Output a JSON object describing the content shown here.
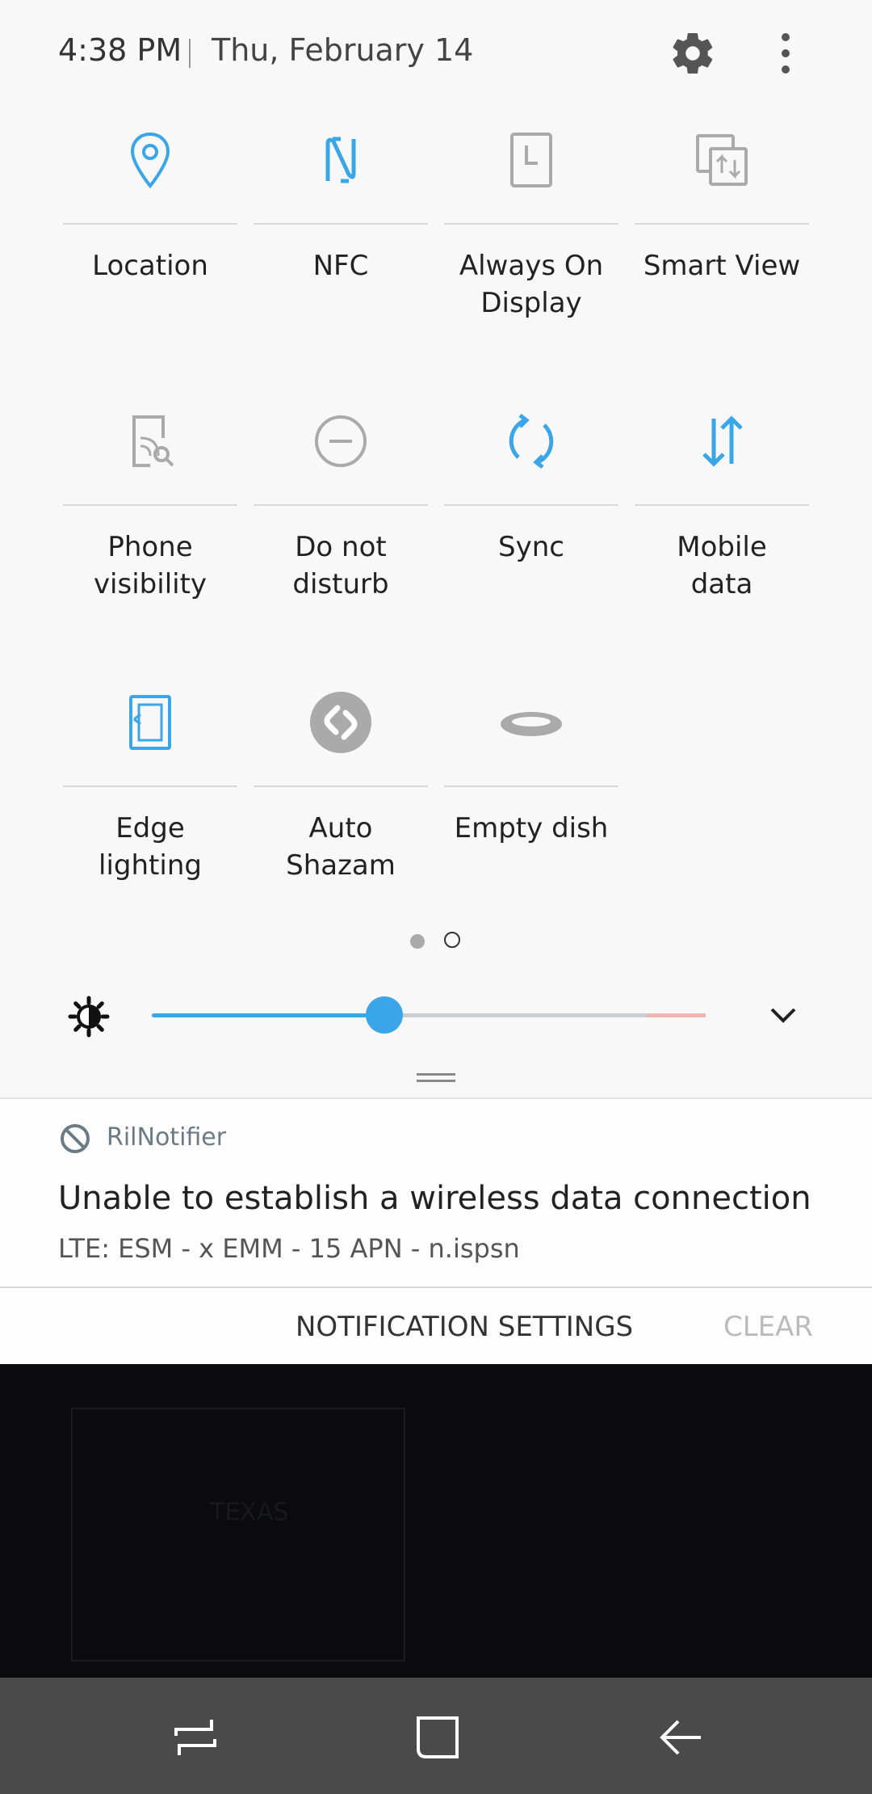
{
  "status": {
    "time": "4:38 PM",
    "date": "Thu, February 14"
  },
  "colors": {
    "accent": "#3aa6e8",
    "inactive": "#aaaaaa"
  },
  "tiles": [
    {
      "label": "Location",
      "icon": "location-icon",
      "active": true
    },
    {
      "label": "NFC",
      "icon": "nfc-icon",
      "active": true
    },
    {
      "label": "Always On\nDisplay",
      "icon": "always-on-display-icon",
      "active": false
    },
    {
      "label": "Smart View",
      "icon": "smart-view-icon",
      "active": false
    },
    {
      "label": "Phone\nvisibility",
      "icon": "phone-visibility-icon",
      "active": false
    },
    {
      "label": "Do not\ndisturb",
      "icon": "do-not-disturb-icon",
      "active": false
    },
    {
      "label": "Sync",
      "icon": "sync-icon",
      "active": true
    },
    {
      "label": "Mobile\ndata",
      "icon": "mobile-data-icon",
      "active": true
    },
    {
      "label": "Edge\nlighting",
      "icon": "edge-lighting-icon",
      "active": true
    },
    {
      "label": "Auto\nShazam",
      "icon": "shazam-icon",
      "active": false
    },
    {
      "label": "Empty dish",
      "icon": "empty-dish-icon",
      "active": false
    }
  ],
  "pager": {
    "pages": 2,
    "current": 1
  },
  "brightness": {
    "level": 0.42
  },
  "notification": {
    "app": "RilNotifier",
    "title": "Unable to establish a wireless data connection",
    "text": "LTE: ESM - x  EMM - 15 APN - n.ispsn"
  },
  "actions": {
    "settings_label": "NOTIFICATION SETTINGS",
    "clear_label": "CLEAR"
  },
  "background": {
    "caption": "TEXAS"
  }
}
